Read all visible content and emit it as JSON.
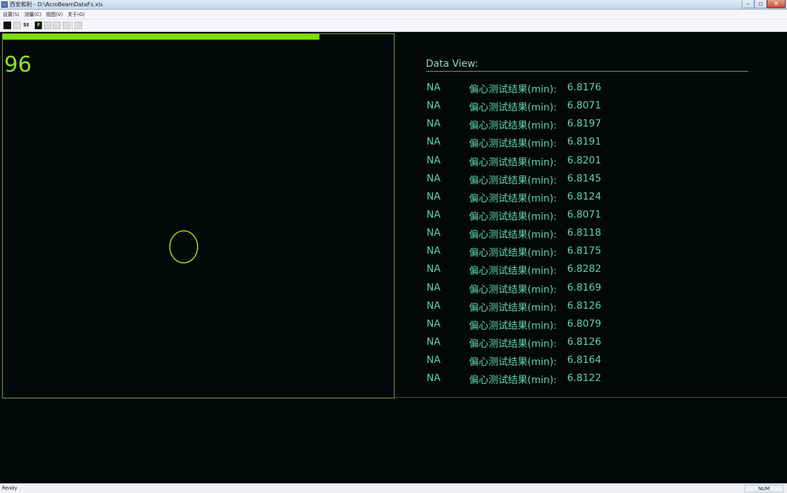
{
  "window": {
    "title": "西安和利",
    "file_path": "D:\\AcroBeamDataFs.xls",
    "min_label": "–",
    "max_label": "▫",
    "close_label": "✕"
  },
  "menu": {
    "items": [
      {
        "label": "设置(S)"
      },
      {
        "label": "测量(C)"
      },
      {
        "label": "视图(V)"
      },
      {
        "label": "关于(G)"
      }
    ]
  },
  "toolbar": {
    "btn1": "",
    "btn2": "",
    "btn3": "St",
    "btn4": "F"
  },
  "plot": {
    "counter": "96",
    "progress": 0.81
  },
  "data_view": {
    "title": "Data View:",
    "rows": [
      {
        "status": "NA",
        "label": "偏心测试结果(min):",
        "value": "6.8176"
      },
      {
        "status": "NA",
        "label": "偏心测试结果(min):",
        "value": "6.8071"
      },
      {
        "status": "NA",
        "label": "偏心测试结果(min):",
        "value": "6.8197"
      },
      {
        "status": "NA",
        "label": "偏心测试结果(min):",
        "value": "6.8191"
      },
      {
        "status": "NA",
        "label": "偏心测试结果(min):",
        "value": "6.8201"
      },
      {
        "status": "NA",
        "label": "偏心测试结果(min):",
        "value": "6.8145"
      },
      {
        "status": "NA",
        "label": "偏心测试结果(min):",
        "value": "6.8124"
      },
      {
        "status": "NA",
        "label": "偏心测试结果(min):",
        "value": "6.8071"
      },
      {
        "status": "NA",
        "label": "偏心测试结果(min):",
        "value": "6.8118"
      },
      {
        "status": "NA",
        "label": "偏心测试结果(min):",
        "value": "6.8175"
      },
      {
        "status": "NA",
        "label": "偏心测试结果(min):",
        "value": "6.8282"
      },
      {
        "status": "NA",
        "label": "偏心测试结果(min):",
        "value": "6.8169"
      },
      {
        "status": "NA",
        "label": "偏心测试结果(min):",
        "value": "6.8126"
      },
      {
        "status": "NA",
        "label": "偏心测试结果(min):",
        "value": "6.8079"
      },
      {
        "status": "NA",
        "label": "偏心测试结果(min):",
        "value": "6.8126"
      },
      {
        "status": "NA",
        "label": "偏心测试结果(min):",
        "value": "6.8164"
      },
      {
        "status": "NA",
        "label": "偏心测试结果(min):",
        "value": "6.8122"
      }
    ]
  },
  "status_bar": {
    "text": "Ready",
    "num": "NUM"
  },
  "colors": {
    "background": "#050808",
    "accent_green": "#7ee000",
    "data_text": "#5ed6a8",
    "target_circle": "#a8d81a"
  }
}
